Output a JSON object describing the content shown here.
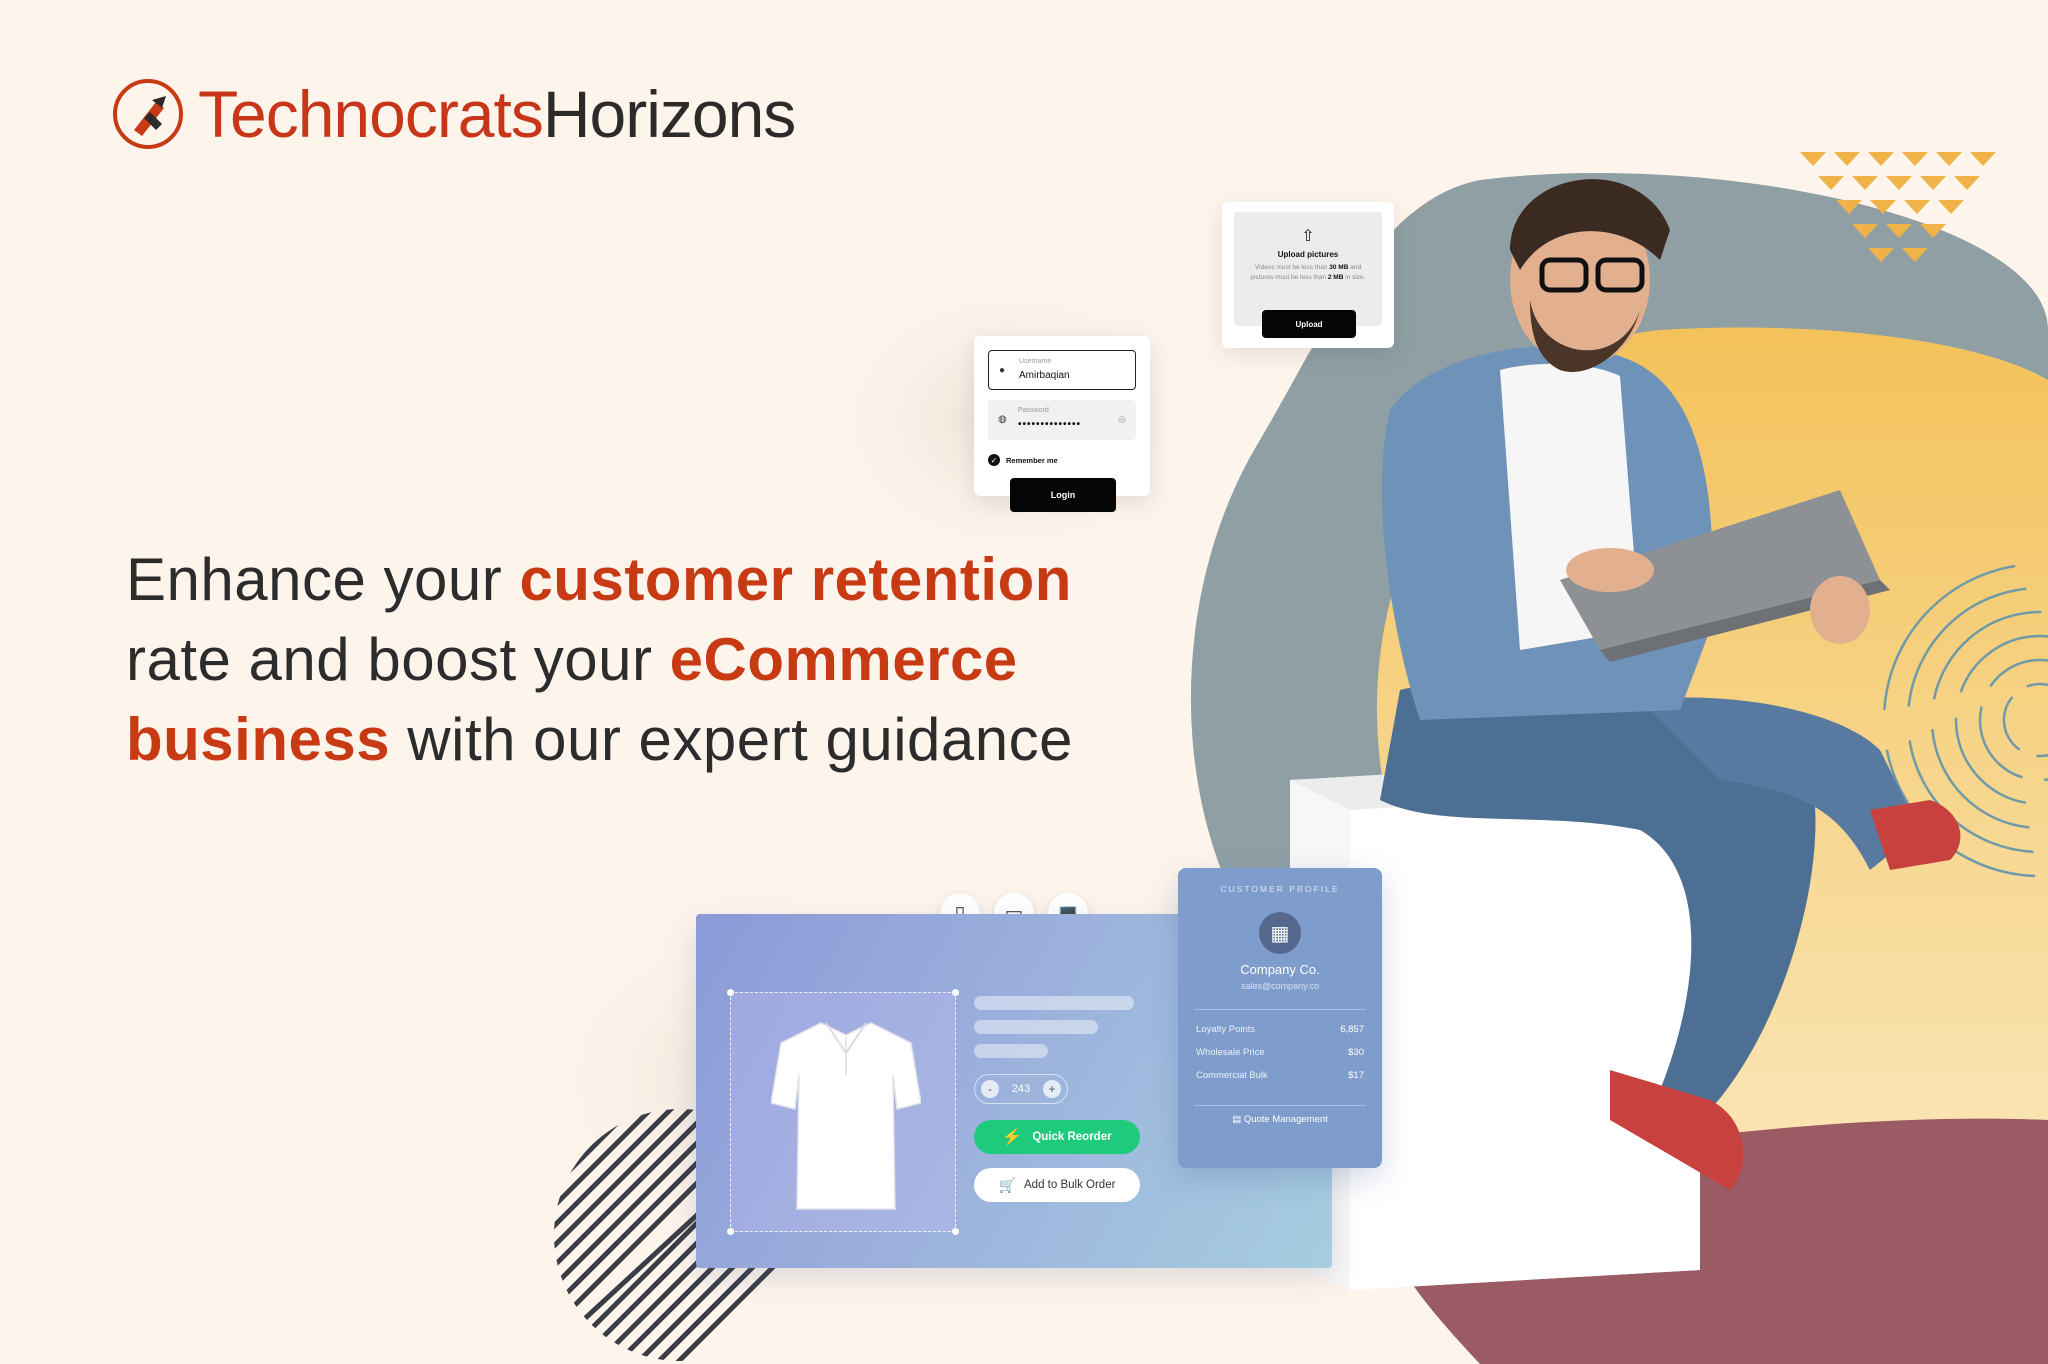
{
  "brand": {
    "name_part1": "Technocrats",
    "name_part2": "Horizons",
    "colors": {
      "primary": "#c73a14",
      "dark": "#2d2a2a",
      "background": "#fdf5ec"
    }
  },
  "headline": {
    "seg1": "Enhance your ",
    "seg2": "customer retention",
    "seg3": " rate and boost your ",
    "seg4": "eCommerce business",
    "seg5": " with our expert guidance"
  },
  "upload_card": {
    "icon": "upload-icon",
    "title": "Upload pictures",
    "note_a": "Videos must be less than ",
    "note_b": "30 MB",
    "note_c": " and pictures must be less than ",
    "note_d": "2 MB",
    "note_e": " in size.",
    "button": "Upload"
  },
  "login_card": {
    "username_label": "Username",
    "username_value": "Amirbaqian",
    "password_label": "Password",
    "password_value": "••••••••••••••",
    "remember_label": "Remember me",
    "button": "Login"
  },
  "product_card": {
    "devices": [
      "mobile-icon",
      "tablet-icon",
      "laptop-icon"
    ],
    "active_device": "laptop-icon",
    "quantity": "243",
    "minus": "-",
    "plus": "+",
    "quick_reorder": "Quick Reorder",
    "add_to_bulk": "Add to Bulk Order",
    "accent_green": "#1ecb7c"
  },
  "customer_profile": {
    "heading": "CUSTOMER PROFILE",
    "company": "Company Co.",
    "email": "sales@company.co",
    "rows": [
      {
        "label": "Loyalty Points",
        "value": "6,857"
      },
      {
        "label": "Wholesale Price",
        "value": "$30"
      },
      {
        "label": "Commercial Bulk",
        "value": "$17"
      }
    ],
    "footer": "Quote Management"
  }
}
